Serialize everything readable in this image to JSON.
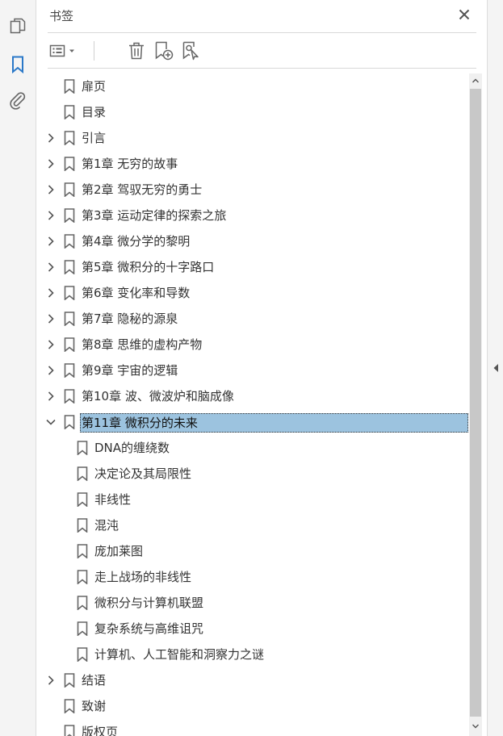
{
  "panel": {
    "title": "书签",
    "close_icon": "close-icon"
  },
  "rail": {
    "items": [
      {
        "icon": "pages-icon",
        "active": false
      },
      {
        "icon": "bookmark-icon",
        "active": true
      },
      {
        "icon": "attachment-icon",
        "active": false
      }
    ]
  },
  "toolbar": {
    "items": [
      "options-menu-icon",
      "delete-icon",
      "new-bookmark-icon",
      "new-bookmark-from-structure-icon"
    ]
  },
  "colors": {
    "accent": "#2a78c8",
    "selected_bg": "#9cc3df",
    "icon": "#666666"
  },
  "bookmarks": [
    {
      "label": "扉页",
      "level": 0,
      "expander": "none"
    },
    {
      "label": "目录",
      "level": 0,
      "expander": "none"
    },
    {
      "label": "引言",
      "level": 0,
      "expander": "collapsed"
    },
    {
      "label": "第1章 无穷的故事",
      "level": 0,
      "expander": "collapsed"
    },
    {
      "label": "第2章 驾驭无穷的勇士",
      "level": 0,
      "expander": "collapsed"
    },
    {
      "label": "第3章 运动定律的探索之旅",
      "level": 0,
      "expander": "collapsed"
    },
    {
      "label": "第4章 微分学的黎明",
      "level": 0,
      "expander": "collapsed"
    },
    {
      "label": "第5章 微积分的十字路口",
      "level": 0,
      "expander": "collapsed"
    },
    {
      "label": "第6章 变化率和导数",
      "level": 0,
      "expander": "collapsed"
    },
    {
      "label": "第7章 隐秘的源泉",
      "level": 0,
      "expander": "collapsed"
    },
    {
      "label": "第8章 思维的虚构产物",
      "level": 0,
      "expander": "collapsed"
    },
    {
      "label": "第9章 宇宙的逻辑",
      "level": 0,
      "expander": "collapsed"
    },
    {
      "label": "第10章 波、微波炉和脑成像",
      "level": 0,
      "expander": "collapsed"
    },
    {
      "label": "第11章 微积分的未来",
      "level": 0,
      "expander": "expanded",
      "selected": true
    },
    {
      "label": "DNA的缠绕数",
      "level": 1,
      "expander": "none"
    },
    {
      "label": "决定论及其局限性",
      "level": 1,
      "expander": "none"
    },
    {
      "label": "非线性",
      "level": 1,
      "expander": "none"
    },
    {
      "label": "混沌",
      "level": 1,
      "expander": "none"
    },
    {
      "label": "庞加莱图",
      "level": 1,
      "expander": "none"
    },
    {
      "label": "走上战场的非线性",
      "level": 1,
      "expander": "none"
    },
    {
      "label": "微积分与计算机联盟",
      "level": 1,
      "expander": "none"
    },
    {
      "label": "复杂系统与高维诅咒",
      "level": 1,
      "expander": "none"
    },
    {
      "label": "计算机、人工智能和洞察力之谜",
      "level": 1,
      "expander": "none"
    },
    {
      "label": "结语",
      "level": 0,
      "expander": "collapsed"
    },
    {
      "label": "致谢",
      "level": 0,
      "expander": "none"
    },
    {
      "label": "版权页",
      "level": 0,
      "expander": "none"
    }
  ]
}
